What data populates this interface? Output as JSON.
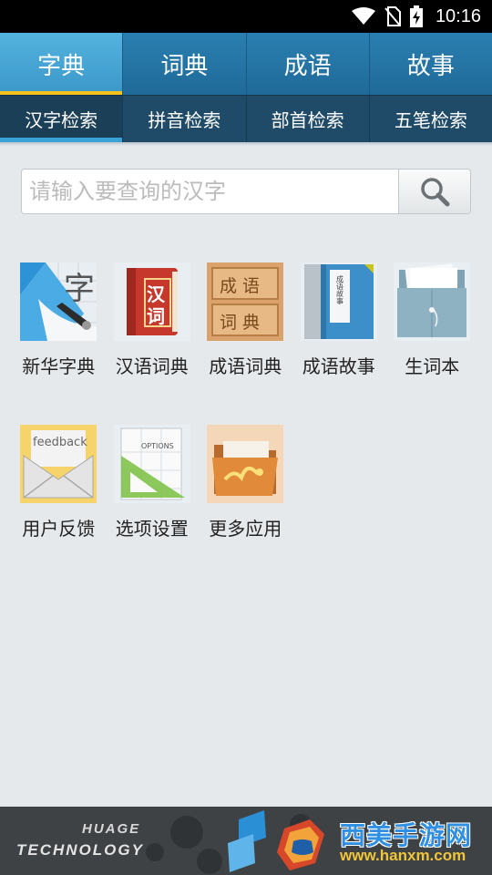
{
  "status_bar": {
    "time": "10:16"
  },
  "main_tabs": [
    {
      "label": "字典"
    },
    {
      "label": "词典"
    },
    {
      "label": "成语"
    },
    {
      "label": "故事"
    }
  ],
  "sub_tabs": [
    {
      "label": "汉字检索"
    },
    {
      "label": "拼音检索"
    },
    {
      "label": "部首检索"
    },
    {
      "label": "五笔检索"
    }
  ],
  "search": {
    "placeholder": "请输入要查询的汉字",
    "button_icon": "search-icon"
  },
  "apps": [
    {
      "label": "新华字典",
      "icon": "brush-dictionary-icon",
      "icon_text": "字"
    },
    {
      "label": "汉语词典",
      "icon": "red-book-icon",
      "icon_text_1": "汉",
      "icon_text_2": "词"
    },
    {
      "label": "成语词典",
      "icon": "wood-tablet-icon",
      "icon_text_1": "成 语",
      "icon_text_2": "词 典"
    },
    {
      "label": "成语故事",
      "icon": "blue-book-icon",
      "icon_text": "成语故事"
    },
    {
      "label": "生词本",
      "icon": "folder-icon"
    },
    {
      "label": "用户反馈",
      "icon": "envelope-icon",
      "icon_text": "feedback"
    },
    {
      "label": "选项设置",
      "icon": "options-icon",
      "icon_text": "OPTIONS"
    },
    {
      "label": "更多应用",
      "icon": "open-folder-icon"
    }
  ],
  "banner": {
    "line1": "HUAGE",
    "line2": "TECHNOLOGY",
    "watermark_cn": "西美手游网",
    "watermark_url": "www.hanxm.com"
  },
  "colors": {
    "tab_active": "#4aa8d8",
    "tab_bg": "#2476a8",
    "subtab_bg": "#1f4b68",
    "accent_yellow": "#f4c21a"
  }
}
